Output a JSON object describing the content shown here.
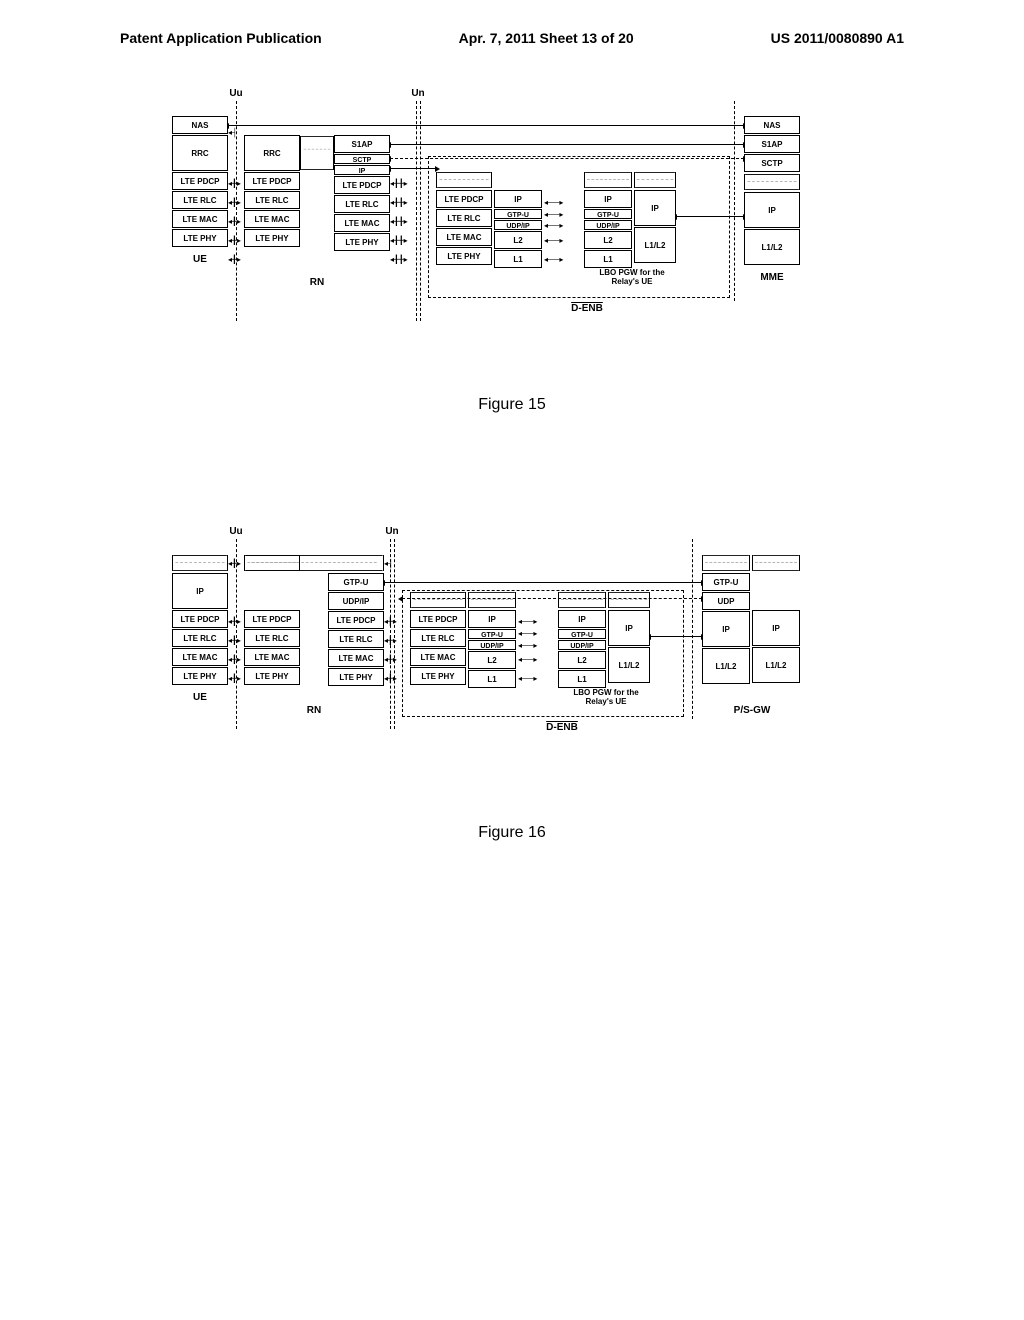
{
  "header": {
    "left": "Patent Application Publication",
    "center": "Apr. 7, 2011   Sheet 13 of 20",
    "right": "US 2011/0080890 A1"
  },
  "figure15": {
    "caption": "Figure 15",
    "iface": {
      "uu": "Uu",
      "un": "Un"
    },
    "nodes": {
      "ue": {
        "label": "UE",
        "layers": [
          "NAS",
          "RRC",
          "LTE PDCP",
          "LTE RLC",
          "LTE MAC",
          "LTE PHY"
        ]
      },
      "rn_left": {
        "layers": [
          "RRC",
          "LTE PDCP",
          "LTE RLC",
          "LTE MAC",
          "LTE PHY"
        ]
      },
      "rn_right": {
        "layers": [
          "S1AP",
          "SCTP",
          "IP",
          "LTE PDCP",
          "LTE RLC",
          "LTE MAC",
          "LTE PHY"
        ]
      },
      "rn_label": "RN",
      "denb_left": {
        "layers": [
          "LTE PDCP",
          "LTE RLC",
          "LTE MAC",
          "LTE PHY"
        ]
      },
      "denb_mid": {
        "layers": [
          "IP",
          "GTP-U",
          "UDP/IP",
          "L2",
          "L1"
        ]
      },
      "denb_right": {
        "layers": [
          "IP",
          "GTP-U",
          "UDP/IP",
          "L2",
          "L1"
        ]
      },
      "denb_ip": "IP",
      "denb_l1l2": "L1/L2",
      "lbo_text": "LBO PGW for the\nRelay's UE",
      "denb_label": "D-ENB",
      "mme": {
        "label": "MME",
        "layers": [
          "NAS",
          "S1AP",
          "SCTP",
          "IP",
          "L1/L2"
        ]
      }
    }
  },
  "figure16": {
    "caption": "Figure 16",
    "iface": {
      "uu": "Uu",
      "un": "Un"
    },
    "nodes": {
      "ue": {
        "label": "UE",
        "top": "IP",
        "layers": [
          "LTE PDCP",
          "LTE RLC",
          "LTE MAC",
          "LTE PHY"
        ]
      },
      "rn_left": {
        "layers": [
          "LTE PDCP",
          "LTE RLC",
          "LTE MAC",
          "LTE PHY"
        ]
      },
      "rn_right": {
        "top": [
          "GTP-U",
          "UDP/IP"
        ],
        "layers": [
          "LTE PDCP",
          "LTE RLC",
          "LTE MAC",
          "LTE PHY"
        ]
      },
      "rn_label": "RN",
      "denb_left": {
        "layers": [
          "LTE PDCP",
          "LTE RLC",
          "LTE MAC",
          "LTE PHY"
        ]
      },
      "denb_mid": {
        "layers": [
          "IP",
          "GTP-U",
          "UDP/IP",
          "L2",
          "L1"
        ]
      },
      "denb_right": {
        "layers": [
          "IP",
          "GTP-U",
          "UDP/IP",
          "L2",
          "L1"
        ]
      },
      "denb_ip": "IP",
      "denb_l1l2": "L1/L2",
      "lbo_text": "LBO PGW for the\nRelay's UE",
      "denb_label": "D-ENB",
      "psgw": {
        "label": "P/S-GW",
        "left": [
          "GTP-U",
          "UDP",
          "IP",
          "L1/L2"
        ],
        "right": [
          "IP",
          "L1/L2"
        ]
      }
    }
  }
}
